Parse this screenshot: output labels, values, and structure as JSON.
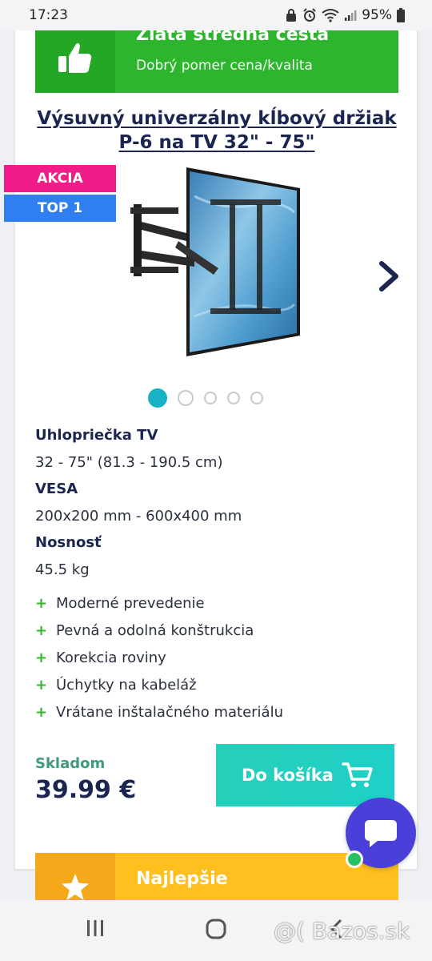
{
  "status_bar": {
    "time": "17:23",
    "battery": "95%"
  },
  "banner_top": {
    "title": "Zlatá stredná cesta",
    "subtitle": "Dobrý pomer cena/kvalita",
    "icon": "thumbs-up-icon",
    "color": "#2db62d"
  },
  "product": {
    "title": "Výsuvný univerzálny kĺbový držiak P-6 na TV 32\" - 75\"",
    "badges": {
      "akcia": "AKCIA",
      "top": "TOP 1"
    },
    "gallery": {
      "dot_count": 5,
      "active_index": 0
    }
  },
  "specs": [
    {
      "label": "Uhlopriečka TV",
      "value": "32 - 75\" (81.3 - 190.5 cm)"
    },
    {
      "label": "VESA",
      "value": "200x200 mm - 600x400 mm"
    },
    {
      "label": "Nosnosť",
      "value": "45.5 kg"
    }
  ],
  "features": [
    {
      "bullet": "+",
      "text": "Moderné prevedenie"
    },
    {
      "bullet": "+",
      "text": "Pevná a odolná konštrukcia"
    },
    {
      "bullet": "+",
      "text": "Korekcia roviny"
    },
    {
      "bullet": "+",
      "text": "Úchytky na kabeláž"
    },
    {
      "bullet": "+",
      "text": "Vrátane inštalačného materiálu"
    }
  ],
  "purchase": {
    "stock": "Skladom",
    "price": "39.99 €",
    "cart_label": "Do košíka"
  },
  "banner_bottom": {
    "title": "Najlepšie",
    "icon": "star-icon",
    "color": "#ffbf1f"
  },
  "watermark": "@( Bazos.sk",
  "colors": {
    "accent_teal": "#1fd0c8",
    "navy": "#1b2550",
    "chat": "#4a3fd9"
  }
}
